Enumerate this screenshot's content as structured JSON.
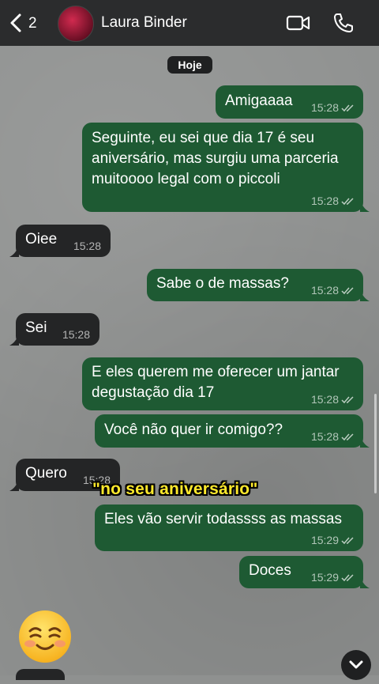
{
  "header": {
    "back_count": "2",
    "contact_name": "Laura Binder"
  },
  "date_chip": "Hoje",
  "messages": [
    {
      "dir": "out",
      "text": "Amigaaaa",
      "time": "15:28"
    },
    {
      "dir": "out",
      "lines": [
        "Seguinte, eu sei que dia 17 é seu",
        "aniversário, mas surgiu uma parceria",
        "muitoooo legal com o piccoli"
      ],
      "time": "15:28"
    },
    {
      "dir": "in",
      "text": "Oiee",
      "time": "15:28"
    },
    {
      "dir": "out",
      "text": "Sabe o de massas?",
      "time": "15:28"
    },
    {
      "dir": "in",
      "text": "Sei",
      "time": "15:28"
    },
    {
      "dir": "out",
      "lines": [
        "E eles querem me oferecer um jantar",
        "degustação dia 17"
      ],
      "time": "15:28"
    },
    {
      "dir": "out",
      "text": "Você não quer ir comigo??",
      "time": "15:28"
    },
    {
      "dir": "in",
      "text": "Quero",
      "time": "15:28"
    },
    {
      "dir": "out",
      "text": "Eles vão servir todassss as massas",
      "time": "15:29"
    },
    {
      "dir": "out",
      "text": "Doces",
      "time": "15:29"
    }
  ],
  "caption": "\"no seu aniversário\"",
  "icons": {
    "back": "chevron-left-icon",
    "video": "video-camera-icon",
    "phone": "phone-icon",
    "scroll": "chevron-down-icon",
    "emoji": "smiling-face-emoji"
  },
  "colors": {
    "outgoing_bubble": "#1e5a33",
    "incoming_bubble": "#242526",
    "header": "#2b2c2d",
    "caption": "#ffe92c"
  }
}
